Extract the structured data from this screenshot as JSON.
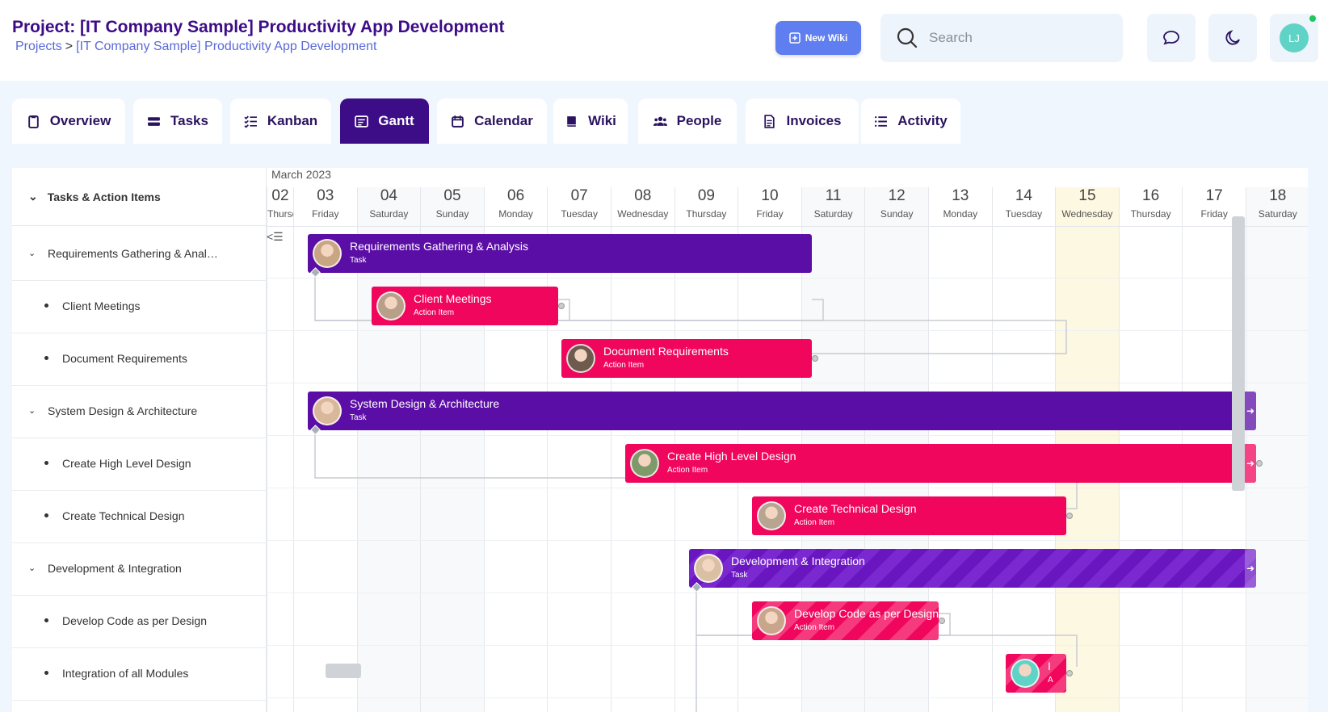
{
  "header": {
    "title": "Project: [IT Company Sample] Productivity App Development",
    "breadcrumb_root": "Projects",
    "breadcrumb_sep": ">",
    "breadcrumb_current": "[IT Company Sample] Productivity App Development",
    "new_wiki_label": "New Wiki",
    "search_placeholder": "Search",
    "user_initials": "LJ"
  },
  "tabs": [
    {
      "label": "Overview",
      "icon": "clipboard-icon",
      "active": false
    },
    {
      "label": "Tasks",
      "icon": "tasks-icon",
      "active": false
    },
    {
      "label": "Kanban",
      "icon": "checklist-icon",
      "active": false
    },
    {
      "label": "Gantt",
      "icon": "gantt-icon",
      "active": true
    },
    {
      "label": "Calendar",
      "icon": "calendar-icon",
      "active": false
    },
    {
      "label": "Wiki",
      "icon": "book-icon",
      "active": false
    },
    {
      "label": "People",
      "icon": "people-icon",
      "active": false
    },
    {
      "label": "Invoices",
      "icon": "invoice-icon",
      "active": false
    },
    {
      "label": "Activity",
      "icon": "list-icon",
      "active": false
    }
  ],
  "gantt": {
    "left_header": "Tasks & Action Items",
    "month": "March 2023",
    "days": [
      {
        "num": "02",
        "name": "Thursday"
      },
      {
        "num": "03",
        "name": "Friday"
      },
      {
        "num": "04",
        "name": "Saturday"
      },
      {
        "num": "05",
        "name": "Sunday"
      },
      {
        "num": "06",
        "name": "Monday"
      },
      {
        "num": "07",
        "name": "Tuesday"
      },
      {
        "num": "08",
        "name": "Wednesday"
      },
      {
        "num": "09",
        "name": "Thursday"
      },
      {
        "num": "10",
        "name": "Friday"
      },
      {
        "num": "11",
        "name": "Saturday"
      },
      {
        "num": "12",
        "name": "Sunday"
      },
      {
        "num": "13",
        "name": "Monday"
      },
      {
        "num": "14",
        "name": "Tuesday"
      },
      {
        "num": "15",
        "name": "Wednesday"
      },
      {
        "num": "16",
        "name": "Thursday"
      },
      {
        "num": "17",
        "name": "Friday"
      },
      {
        "num": "18",
        "name": "Saturday"
      }
    ],
    "rows": [
      {
        "label": "Requirements Gathering & Anal…",
        "kind": "parent"
      },
      {
        "label": "Client Meetings",
        "kind": "child"
      },
      {
        "label": "Document Requirements",
        "kind": "child"
      },
      {
        "label": "System Design & Architecture",
        "kind": "parent"
      },
      {
        "label": "Create High Level Design",
        "kind": "child"
      },
      {
        "label": "Create Technical Design",
        "kind": "child"
      },
      {
        "label": "Development & Integration",
        "kind": "parent"
      },
      {
        "label": "Develop Code as per Design",
        "kind": "child"
      },
      {
        "label": "Integration of all Modules",
        "kind": "child"
      }
    ],
    "bars": [
      {
        "title": "Requirements Gathering & Analysis",
        "type": "Task"
      },
      {
        "title": "Client Meetings",
        "type": "Action Item"
      },
      {
        "title": "Document Requirements",
        "type": "Action Item"
      },
      {
        "title": "System Design & Architecture",
        "type": "Task"
      },
      {
        "title": "Create High Level Design",
        "type": "Action Item"
      },
      {
        "title": "Create Technical Design",
        "type": "Action Item"
      },
      {
        "title": "Development & Integration",
        "type": "Task"
      },
      {
        "title": "Develop Code as per Design",
        "type": "Action Item"
      },
      {
        "title": "I",
        "type": "A"
      }
    ]
  },
  "colors": {
    "task": "#5b0ea6",
    "action_item": "#f0065d",
    "accent": "#3d0c87",
    "today_highlight": "#fdf8e1"
  }
}
